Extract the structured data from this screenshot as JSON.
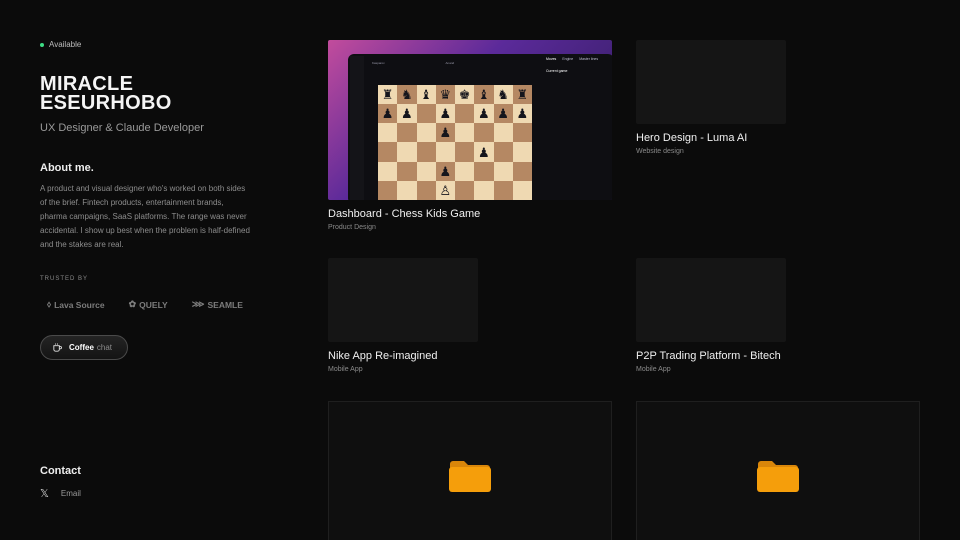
{
  "profile": {
    "status": "Available",
    "name": "MIRACLE ESEURHOBO",
    "role": "UX Designer & Claude Developer",
    "about_heading": "About me.",
    "about_text": "A product and visual designer who's worked on both sides of the brief. Fintech products, entertainment brands, pharma campaigns, SaaS platforms. The range was never accidental. I show up best when the problem is half-defined and the stakes are real.",
    "trusted_label": "TRUSTED BY",
    "logos": [
      {
        "name": "Lava Source",
        "icon": "lava-icon"
      },
      {
        "name": "QUELY",
        "icon": "quely-icon"
      },
      {
        "name": "SEAMLE",
        "icon": "seamless-icon"
      }
    ],
    "coffee_strong": "Coffee",
    "coffee_light": "chat",
    "contact_heading": "Contact",
    "contact_email_label": "Email"
  },
  "projects": [
    {
      "title": "Dashboard - Chess Kids Game",
      "category": "Product Design"
    },
    {
      "title": "Hero Design - Luma AI",
      "category": "Website design"
    },
    {
      "title": "Nike App Re-imagined",
      "category": "Mobile App"
    },
    {
      "title": "P2P Trading Platform - Bitech",
      "category": "Mobile App"
    }
  ],
  "chess": {
    "player_left": "Kasparov",
    "player_right": "Anand",
    "tabs": [
      "Moves",
      "Engine",
      "Master lines"
    ],
    "panel_title": "Current game"
  },
  "colors": {
    "accent_green": "#3ddc84",
    "folder": "#f59e0b"
  }
}
